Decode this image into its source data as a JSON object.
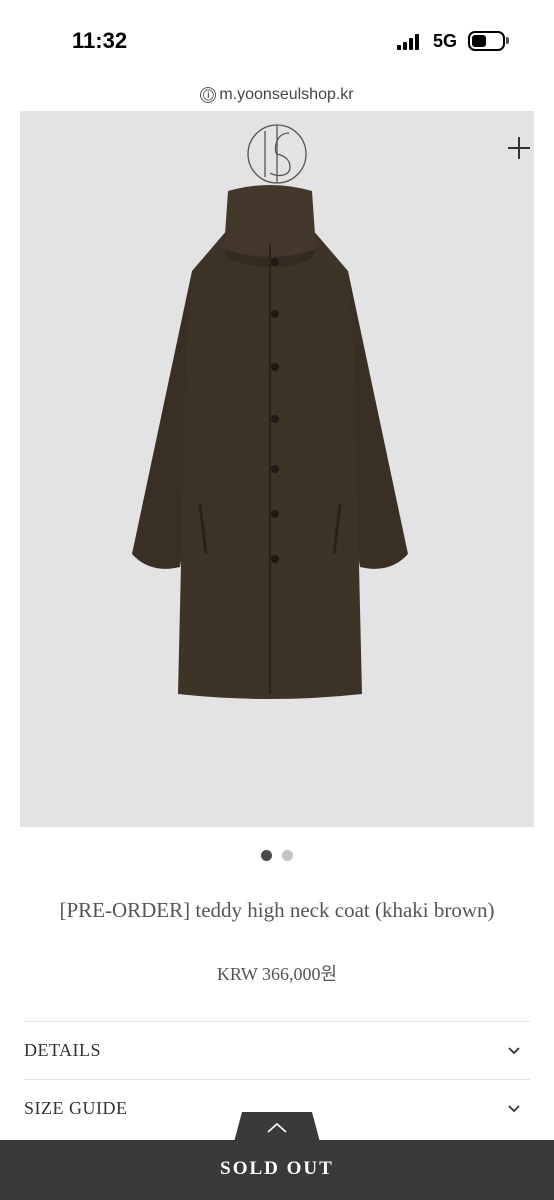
{
  "status_bar": {
    "time": "11:32",
    "network": "5G"
  },
  "browser": {
    "url": "m.yoonseulshop.kr",
    "url_icon": "ⓘ"
  },
  "gallery": {
    "image_alt": "teddy high neck coat khaki brown",
    "current_slide": 1,
    "total_slides": 2
  },
  "product": {
    "title": "[PRE-ORDER] teddy high neck coat (khaki brown)",
    "price": "KRW 366,000원"
  },
  "accordion": [
    {
      "label": "DETAILS"
    },
    {
      "label": "SIZE GUIDE"
    }
  ],
  "action": {
    "sold_out_label": "SOLD OUT"
  },
  "colors": {
    "image_background": "#e3e3e5",
    "coat": "#3d3226",
    "sold_out_bar": "#3a3a3a"
  },
  "icons": [
    "signal-icon",
    "battery-icon",
    "info-icon",
    "brand-logo",
    "plus-icon",
    "chevron-down-icon",
    "chevron-up-icon"
  ]
}
